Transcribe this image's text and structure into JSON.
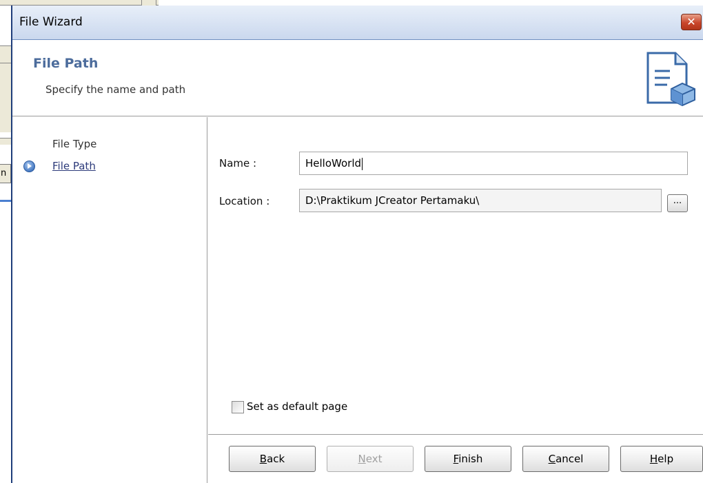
{
  "background": {
    "tab_fragment": "n"
  },
  "dialog": {
    "title": "File Wizard",
    "close_glyph": "✕"
  },
  "header": {
    "title": "File Path",
    "subtitle": "Specify the name and path",
    "icon": "document-wizard-icon"
  },
  "nav": {
    "items": [
      {
        "label": "File Type",
        "active": false
      },
      {
        "label": "File Path",
        "active": true
      }
    ]
  },
  "form": {
    "name_label": "Name :",
    "name_value": "HelloWorld",
    "location_label": "Location :",
    "location_value": "D:\\Praktikum JCreator Pertamaku\\",
    "browse_label": "...",
    "default_checkbox_label": "Set as default page",
    "default_checked": false
  },
  "buttons": {
    "back": {
      "first": "B",
      "rest": "ack"
    },
    "next": {
      "first": "N",
      "rest": "ext"
    },
    "finish": {
      "first": "F",
      "rest": "inish"
    },
    "cancel": {
      "first": "C",
      "rest": "ancel"
    },
    "help": {
      "first": "H",
      "rest": "elp"
    }
  },
  "colors": {
    "header_title": "#4c6c9c",
    "close_button": "#c9462b",
    "titlebar_gradient_top": "#e8eff9"
  }
}
